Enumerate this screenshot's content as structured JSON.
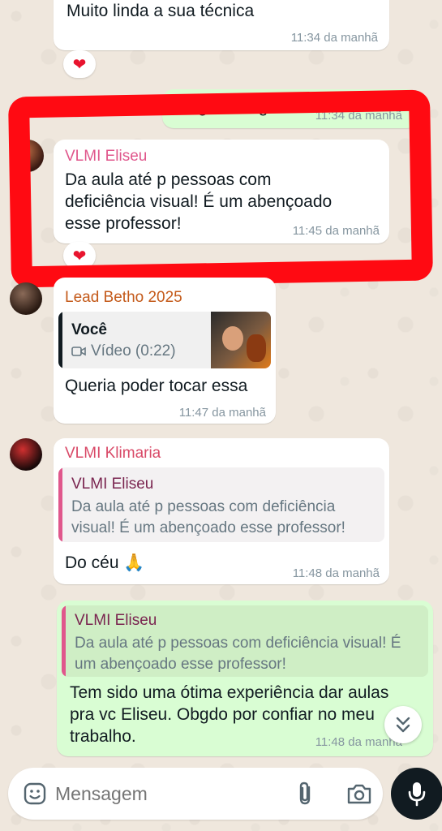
{
  "colors": {
    "incoming_bubble": "#ffffff",
    "outgoing_bubble": "#d9fdd3",
    "eliseu_name": "#e0578c",
    "lead_name": "#c45a1a",
    "klimaria_name": "#d94a68",
    "quote_klimaria_bar": "#e0578c",
    "annotation_red": "#ff0a12"
  },
  "messages": {
    "m1": {
      "text": "Muito linda a sua técnica",
      "time": "11:34 da manhã",
      "reaction": "❤"
    },
    "m2": {
      "text": "Obgdo amigo.",
      "time": "11:34 da manhã"
    },
    "m3": {
      "sender": "VLMI Eliseu",
      "text_lines": [
        "Da aula até p pessoas com",
        "deficiência visual! É um abençoado",
        "esse professor!"
      ],
      "time": "11:45 da manhã",
      "reaction": "❤"
    },
    "m4": {
      "sender": "Lead Betho 2025",
      "quote_sender": "Você",
      "quote_media": "Vídeo (0:22)",
      "text": "Queria poder tocar essa",
      "time": "11:47 da manhã"
    },
    "m5": {
      "sender": "VLMI Klimaria",
      "quote_sender": "VLMI Eliseu",
      "quote_lines": [
        "Da aula até p pessoas com deficiência",
        "visual! É um abençoado esse professor!"
      ],
      "text": "Do céu 🙏",
      "time": "11:48 da manhã"
    },
    "m6": {
      "quote_sender": "VLMI Eliseu",
      "quote_lines": [
        "Da aula até p pessoas com deficiência visual! É",
        "um abençoado esse professor!"
      ],
      "text_lines": [
        "Tem sido uma ótima experiência dar aulas",
        "pra vc Eliseu. Obgdo por confiar no meu",
        "trabalho."
      ],
      "time": "11:48 da manhã"
    }
  },
  "input": {
    "placeholder": "Mensagem"
  }
}
